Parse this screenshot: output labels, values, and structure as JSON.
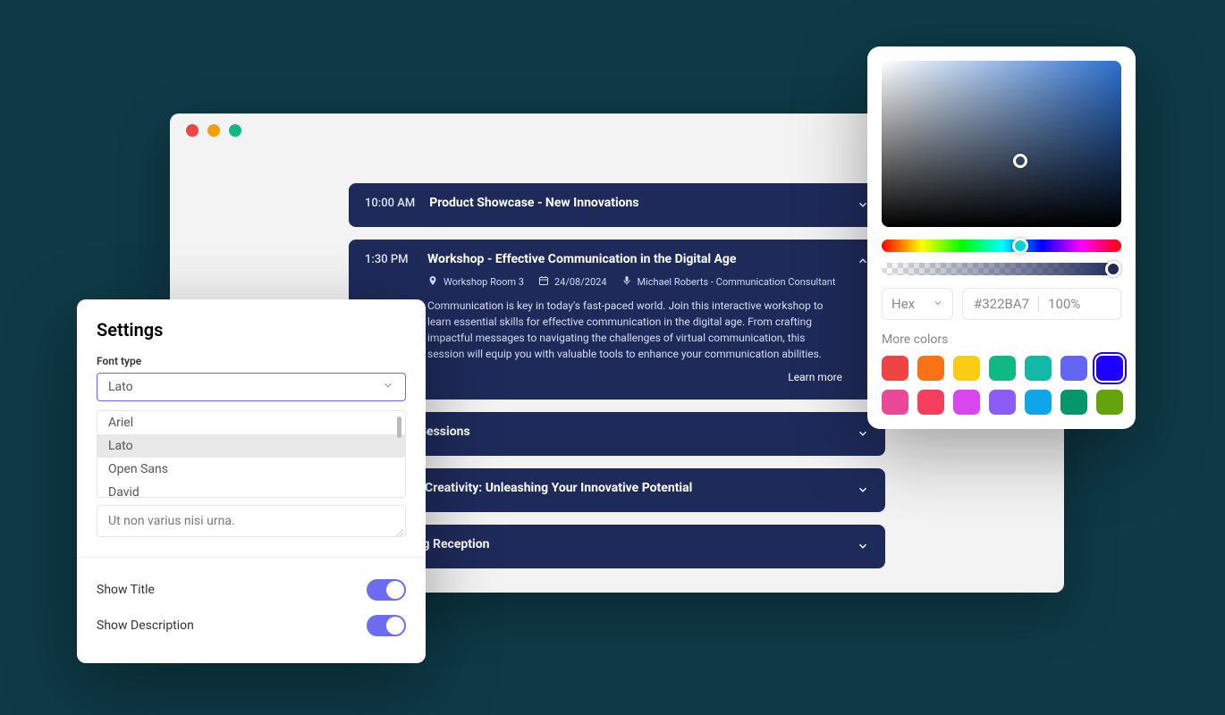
{
  "browser": {
    "agenda": [
      {
        "time": "10:00 AM",
        "title": "Product Showcase - New Innovations",
        "expanded": false
      },
      {
        "time": "1:30 PM",
        "title": "Workshop - Effective Communication in the Digital Age",
        "expanded": true,
        "location": "Workshop Room 3",
        "date": "24/08/2024",
        "speaker": "Michael Roberts - Communication Consultant",
        "description": "Communication is key in today's fast-paced world. Join this interactive workshop to learn essential skills for effective communication in the digital age. From crafting impactful messages to navigating the challenges of virtual communication, this session will equip you with valuable tools to enhance your communication abilities.",
        "learn_more": "Learn more"
      },
      {
        "time": "",
        "title": "Breakout Sessions",
        "expanded": false
      },
      {
        "time": "",
        "title": "The Art of Creativity: Unleashing Your Innovative Potential",
        "expanded": false
      },
      {
        "time": "",
        "title": "Networking Reception",
        "expanded": false
      }
    ]
  },
  "settings": {
    "heading": "Settings",
    "font_type_label": "Font type",
    "font_selected": "Lato",
    "font_options": [
      "Ariel",
      "Lato",
      "Open Sans",
      "David"
    ],
    "textarea_value": "Ut non varius nisi urna.",
    "show_title_label": "Show Title",
    "show_description_label": "Show Description",
    "show_title": true,
    "show_description": true
  },
  "picker": {
    "mode": "Hex",
    "hex": "#322BA7",
    "alpha": "100%",
    "more_colors_label": "More colors",
    "swatches": [
      "#ef4444",
      "#f97316",
      "#facc15",
      "#10b981",
      "#14b8a6",
      "#6366f1",
      "#1e00ff",
      "#ec4899",
      "#f43f5e",
      "#d946ef",
      "#8b5cf6",
      "#0ea5e9",
      "#059669",
      "#65a30d"
    ],
    "selected_swatch_index": 6
  }
}
